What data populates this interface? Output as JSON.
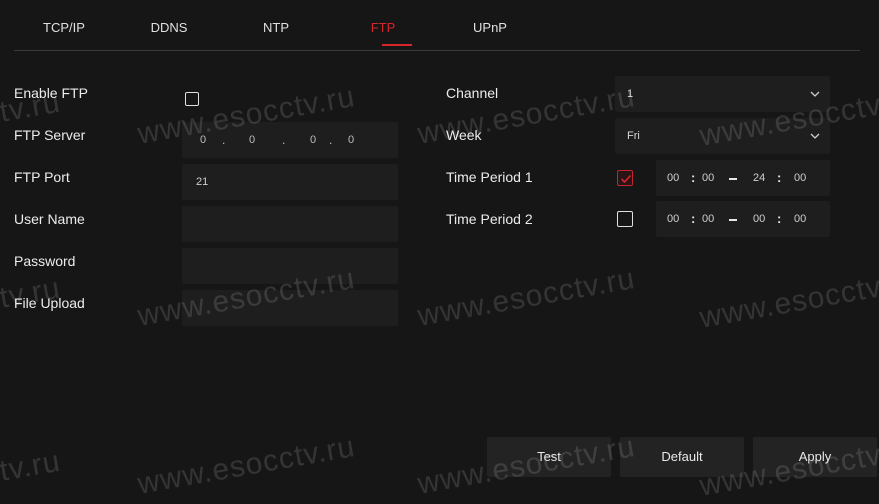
{
  "tabs": [
    {
      "label": "TCP/IP",
      "active": false
    },
    {
      "label": "DDNS",
      "active": false
    },
    {
      "label": "NTP",
      "active": false
    },
    {
      "label": "FTP",
      "active": true
    },
    {
      "label": "UPnP",
      "active": false
    }
  ],
  "left": {
    "enable_ftp": {
      "label": "Enable FTP",
      "checked": false
    },
    "ftp_server": {
      "label": "FTP Server",
      "octets": [
        "0",
        "0",
        "0",
        "0"
      ]
    },
    "ftp_port": {
      "label": "FTP Port",
      "value": "21"
    },
    "user_name": {
      "label": "User Name",
      "value": ""
    },
    "password": {
      "label": "Password",
      "value": ""
    },
    "file_upload": {
      "label": "File Upload",
      "value": ""
    }
  },
  "right": {
    "channel": {
      "label": "Channel",
      "value": "1"
    },
    "week": {
      "label": "Week",
      "value": "Fri"
    },
    "time_period_1": {
      "label": "Time Period 1",
      "checked": true,
      "start_h": "00",
      "start_m": "00",
      "end_h": "24",
      "end_m": "00"
    },
    "time_period_2": {
      "label": "Time Period 2",
      "checked": false,
      "start_h": "00",
      "start_m": "00",
      "end_h": "00",
      "end_m": "00"
    }
  },
  "buttons": {
    "test": "Test",
    "default": "Default",
    "apply": "Apply"
  },
  "watermark": "www.esocctv.ru",
  "watermark_fragment": "tv.ru",
  "colors": {
    "accent": "#d8242b",
    "background": "#161616",
    "field": "#1e1e1e"
  }
}
